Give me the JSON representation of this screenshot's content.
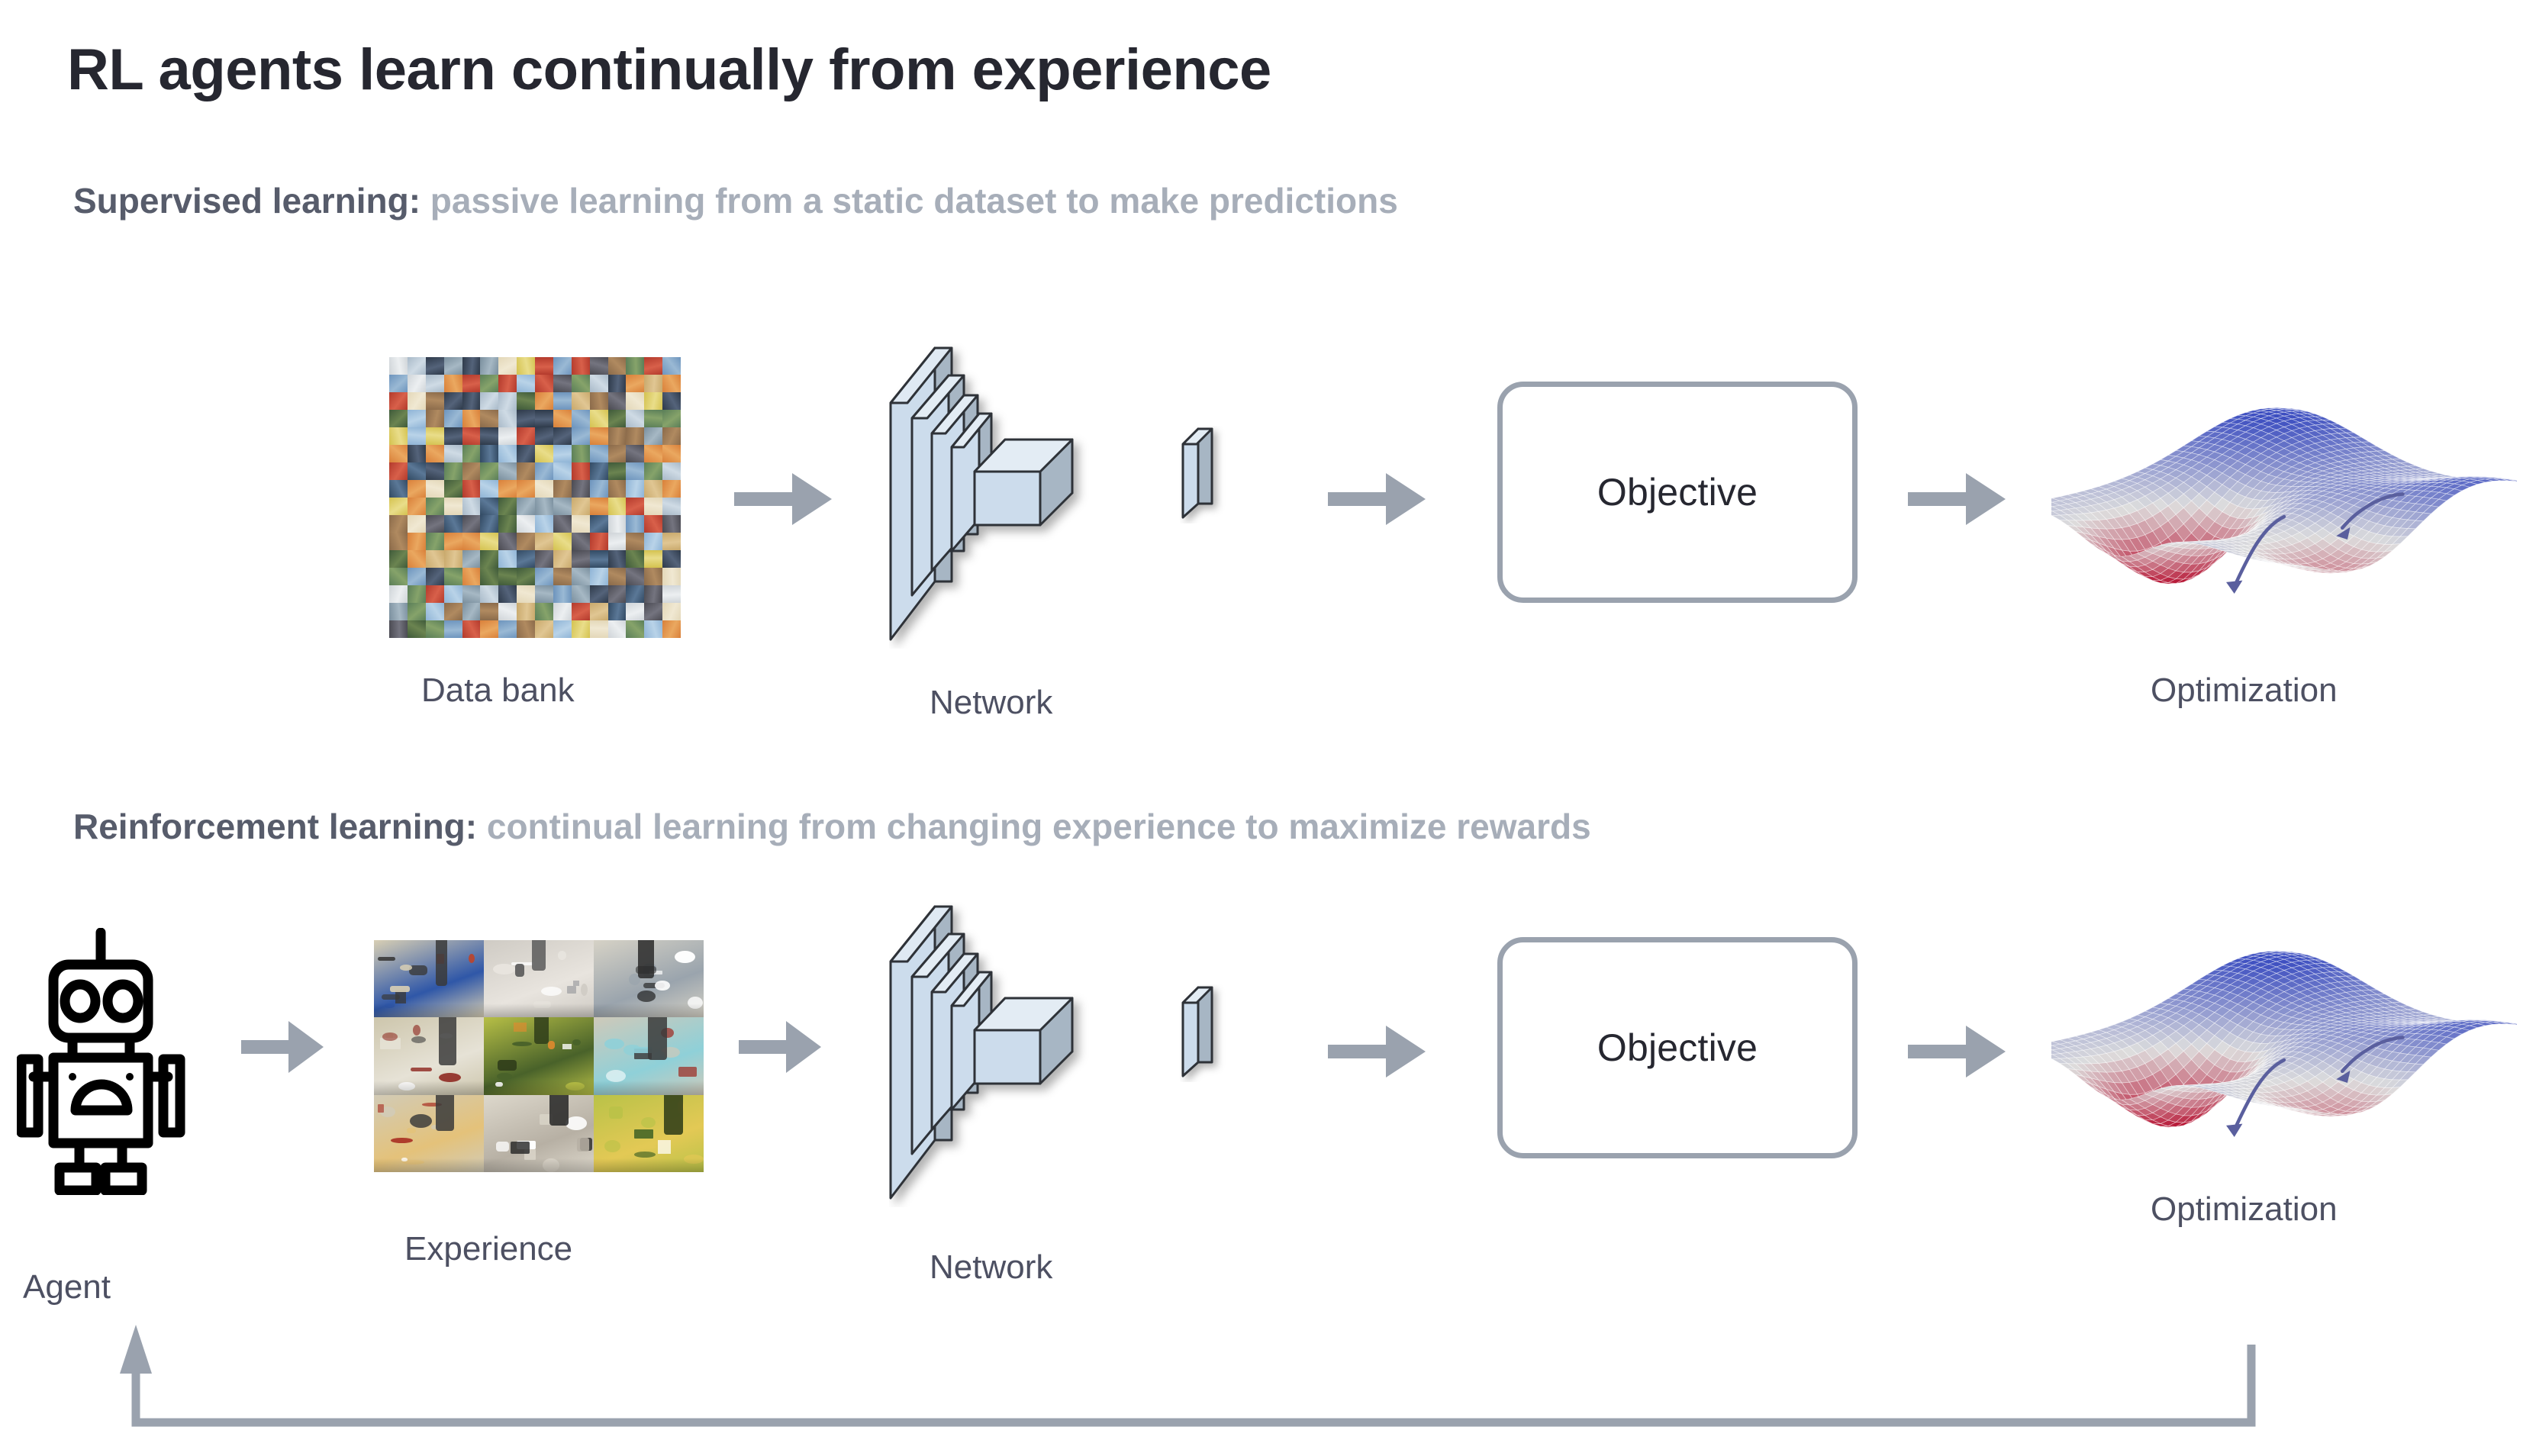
{
  "page": {
    "title": "RL agents learn continually from experience",
    "background": "#ffffff",
    "title_color": "#262730",
    "label_color": "#4d5062",
    "arrow_color": "#9aa2ae",
    "box_border_color": "#9aa2ae",
    "slab_fill": "#ccdcec",
    "slab_side": "#a9b7c4",
    "slab_stroke": "#2f3338"
  },
  "sections": [
    {
      "id": "supervised",
      "label": "Supervised learning:",
      "description": "passive learning from a static dataset to make predictions",
      "label_color": "#575c6b",
      "description_color": "#a7aeb9",
      "nodes": [
        {
          "name": "data-bank",
          "caption": "Data bank"
        },
        {
          "name": "network",
          "caption": "Network"
        },
        {
          "name": "output-layer",
          "caption": ""
        },
        {
          "name": "objective",
          "caption": "Objective"
        },
        {
          "name": "optimization",
          "caption": "Optimization"
        }
      ]
    },
    {
      "id": "reinforcement",
      "label": "Reinforcement learning:",
      "description": "continual learning from changing experience to maximize rewards",
      "label_color": "#575c6b",
      "description_color": "#a7aeb9",
      "nodes": [
        {
          "name": "agent",
          "caption": "Agent"
        },
        {
          "name": "experience",
          "caption": "Experience"
        },
        {
          "name": "network",
          "caption": "Network"
        },
        {
          "name": "output-layer",
          "caption": ""
        },
        {
          "name": "objective",
          "caption": "Objective"
        },
        {
          "name": "optimization",
          "caption": "Optimization"
        }
      ]
    }
  ],
  "labels": {
    "data_bank": "Data bank",
    "network_top": "Network",
    "objective_top": "Objective",
    "optimization_top": "Optimization",
    "agent": "Agent",
    "experience": "Experience",
    "network_bottom": "Network",
    "objective_bottom": "Objective",
    "optimization_bottom": "Optimization"
  },
  "icons": {
    "agent": "robot-icon",
    "flow": "right-arrow-icon",
    "feedback": "feedback-loop-arrow-icon",
    "network": "neural-network-3d-icon",
    "optimization": "loss-surface-icon"
  },
  "chart_data": {
    "type": "surface",
    "title": "Optimization",
    "colormap": "coolwarm",
    "annotations": [
      {
        "name": "descent-arrow-left",
        "path": "from ridge down to deep red global minimum"
      },
      {
        "name": "descent-arrow-right",
        "path": "from right ridge down into shallow local minimum"
      }
    ],
    "note": "3D loss landscape mesh with two gradient-descent trajectory arrows"
  }
}
